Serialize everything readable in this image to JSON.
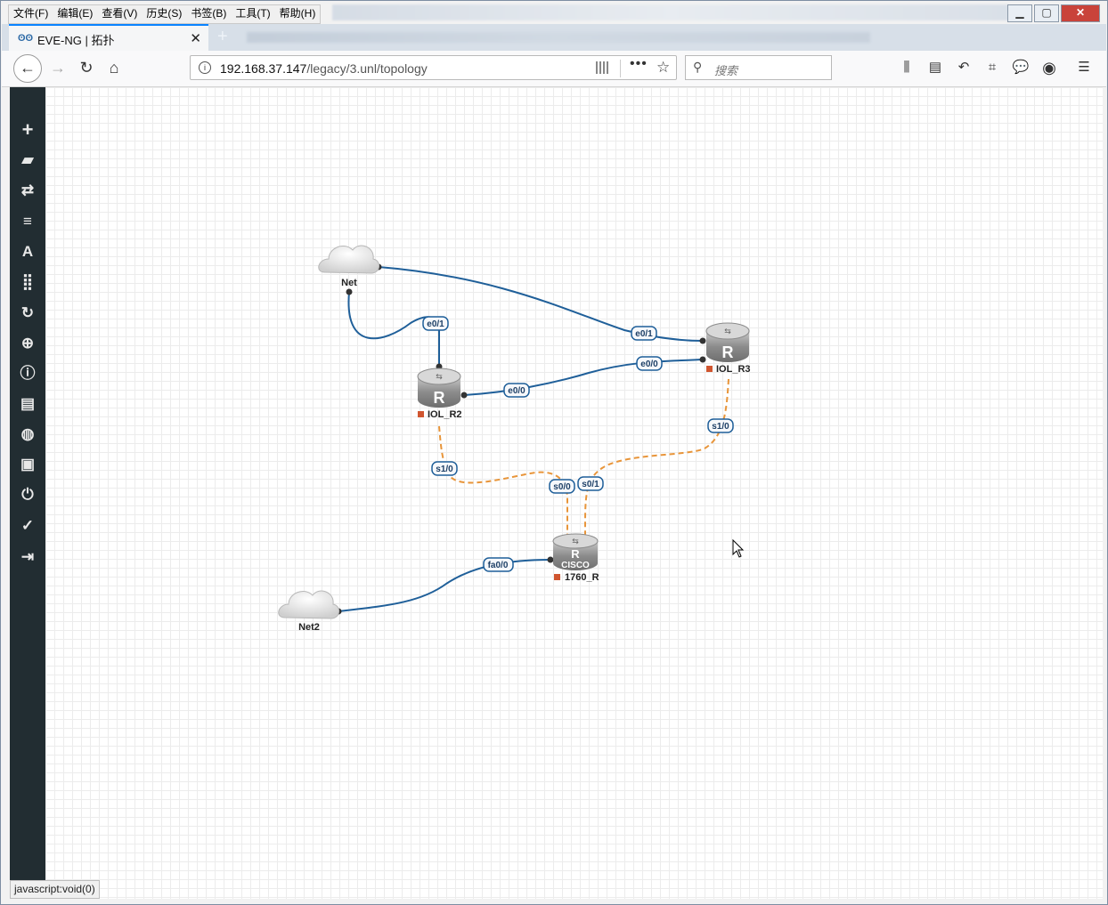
{
  "menubar": [
    "文件(F)",
    "编辑(E)",
    "查看(V)",
    "历史(S)",
    "书签(B)",
    "工具(T)",
    "帮助(H)"
  ],
  "tab": {
    "title": "EVE-NG | 拓扑",
    "close": "✕"
  },
  "address": {
    "host": "192.168.37.147",
    "path": "/legacy/3.unl/topology"
  },
  "search_placeholder": "搜索",
  "status_bar": "javascript:void(0)",
  "sidebar_icons": [
    "add-icon",
    "storage-icon",
    "transfer-icon",
    "list-icon",
    "text-icon",
    "grid-icon",
    "refresh-icon",
    "zoom-icon",
    "info-icon",
    "log-icon",
    "globe-icon",
    "briefcase-icon",
    "power-icon",
    "check-icon",
    "logout-icon"
  ],
  "nodes": {
    "net": "Net",
    "net2": "Net2",
    "r2": "IOL_R2",
    "r3": "IOL_R3",
    "r1760": "1760_R"
  },
  "interfaces": {
    "r2_e0_1": "e0/1",
    "r3_e0_1": "e0/1",
    "r3_e0_0": "e0/0",
    "r2_e0_0": "e0/0",
    "r3_s1_0": "s1/0",
    "r2_s1_0": "s1/0",
    "r1760_s0_0": "s0/0",
    "r1760_s0_1": "s0/1",
    "r1760_fa0_0": "fa0/0"
  },
  "colors": {
    "ethernet_link": "#1f5f99",
    "serial_link": "#e8953a",
    "sidebar_bg": "#222d32",
    "node_stopped": "#d0552f"
  }
}
